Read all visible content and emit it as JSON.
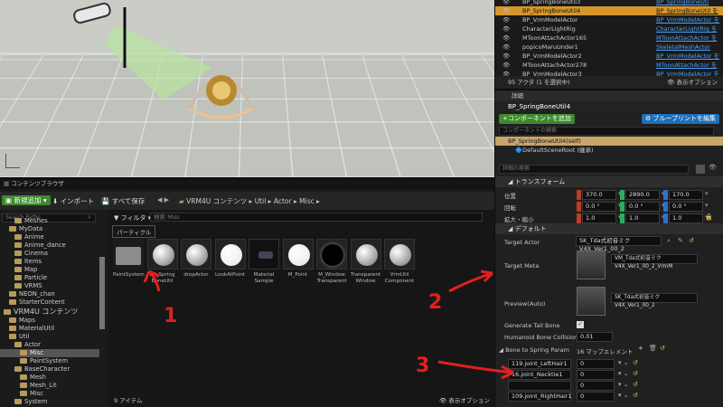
{
  "outliner": {
    "rows": [
      {
        "name": "BP_SpringBoneUtil3",
        "type": "BP_SpringBoneUti",
        "sel": false
      },
      {
        "name": "BP_SpringBoneUtil4",
        "type": "BP_SpringBoneUtil を",
        "sel": true
      },
      {
        "name": "BP_VrmModelActor",
        "type": "BP_VrmModelActor を",
        "sel": false
      },
      {
        "name": "CharacterLightRig",
        "type": "CharacterLightRig を",
        "sel": false
      },
      {
        "name": "MToonAttachActor165",
        "type": "MToonAttachActor を",
        "sel": false
      },
      {
        "name": "popicoMaruUnder1",
        "type": "SkeletalMeshActor",
        "sel": false
      },
      {
        "name": "BP_VrmModelActor2",
        "type": "BP_VrmModelActor を",
        "sel": false
      },
      {
        "name": "MToonAttachActor278",
        "type": "MToonAttachActor を",
        "sel": false
      },
      {
        "name": "BP_VrmModelActor3",
        "type": "BP_VrmModelActor を",
        "sel": false
      }
    ],
    "footer": "95 アクタ (1 を選択中)",
    "view_options": "表示オプション"
  },
  "details": {
    "tab": "詳細",
    "actor_name": "BP_SpringBoneUtil4",
    "add_component": "+コンポーネントを追加",
    "edit_blueprint": "ブループリントを編集",
    "component_search": "コンポーネントの検索",
    "self_item": "BP_SpringBoneUtil4(self)",
    "root_item": "DefaultSceneRoot (継承)",
    "details_search": "詳細の検索",
    "transform_header": "トランスフォーム",
    "location_label": "位置",
    "rotation_label": "回転",
    "scale_label": "拡大・縮小",
    "location": [
      "370.0",
      "2890.0",
      "170.0"
    ],
    "rotation": [
      "0.0 °",
      "0.0 °",
      "0.0 °"
    ],
    "scale": [
      "1.0",
      "1.0",
      "1.0"
    ],
    "default_header": "デフォルト",
    "target_actor_label": "Target Actor",
    "target_actor_value": "SK_Tda式初音ミクV4X_Ver1_00_2",
    "target_meta_label": "Target Meta",
    "target_meta_value": "VM_Tda式初音ミクV4X_Ver1_00_2_VrmM",
    "preview_label": "Preview(Auto)",
    "preview_value": "SK_Tda式初音ミクV4X_Ver1_00_2",
    "gen_tail_label": "Generate Tail Bone",
    "collision_label": "Humanoid Bone Collision Rad",
    "collision_value": "0.01",
    "bone_map_label": "Bone to Spring Param",
    "bone_map_count": "16 マップエレメント",
    "bones": [
      {
        "key": "119.joint_LeftHair1",
        "val": "0"
      },
      {
        "key": "16.joint_Necktie1",
        "val": "0"
      },
      {
        "key": "",
        "val": "0"
      },
      {
        "key": "109.joint_RightHair1",
        "val": "0"
      }
    ]
  },
  "content_browser": {
    "tab": "コンテンツブラウザ",
    "add_new": "新規追加",
    "import": "インポート",
    "save_all": "すべて保存",
    "path": [
      "VRM4U コンテンツ",
      "Util",
      "Actor",
      "Misc"
    ],
    "filter": "フィルタ",
    "search_placeholder": "検索 Misc",
    "search_paths": "Search Paths",
    "collection": "パーティクル",
    "item_count": "9 アイテム",
    "view_options": "表示オプション",
    "tree": [
      {
        "t": "Meshes",
        "lv": 2,
        "big": false
      },
      {
        "t": "MyData",
        "lv": 1,
        "big": false
      },
      {
        "t": "Anime",
        "lv": 2,
        "big": false
      },
      {
        "t": "Anime_dance",
        "lv": 2,
        "big": false
      },
      {
        "t": "Cinema",
        "lv": 2,
        "big": false
      },
      {
        "t": "Items",
        "lv": 2,
        "big": false
      },
      {
        "t": "Map",
        "lv": 2,
        "big": false
      },
      {
        "t": "Particle",
        "lv": 2,
        "big": false
      },
      {
        "t": "VRMS",
        "lv": 2,
        "big": false
      },
      {
        "t": "NEON_chan",
        "lv": 1,
        "big": false
      },
      {
        "t": "StarterContent",
        "lv": 1,
        "big": false
      },
      {
        "t": "VRM4U コンテンツ",
        "lv": 0,
        "big": true
      },
      {
        "t": "Maps",
        "lv": 1,
        "big": false
      },
      {
        "t": "MaterialUtil",
        "lv": 1,
        "big": false
      },
      {
        "t": "Util",
        "lv": 1,
        "big": false
      },
      {
        "t": "Actor",
        "lv": 2,
        "big": false
      },
      {
        "t": "Misc",
        "lv": 3,
        "big": false,
        "sel": true
      },
      {
        "t": "PaintSystem",
        "lv": 3,
        "big": false
      },
      {
        "t": "BaseCharacter",
        "lv": 2,
        "big": false
      },
      {
        "t": "Mesh",
        "lv": 3,
        "big": false
      },
      {
        "t": "Mesh_Lit",
        "lv": 3,
        "big": false
      },
      {
        "t": "Misc",
        "lv": 3,
        "big": false
      },
      {
        "t": "System",
        "lv": 2,
        "big": false
      },
      {
        "t": "VRM4U C++ クラス",
        "lv": 0,
        "big": true
      }
    ],
    "assets": [
      {
        "name": "PaintSystem",
        "kind": "folder"
      },
      {
        "name": "BP_Spring BoneUtil",
        "kind": "sphere"
      },
      {
        "name": "dropActor",
        "kind": "sphere"
      },
      {
        "name": "LookAtPoint",
        "kind": "white"
      },
      {
        "name": "Material Sample",
        "kind": "dark"
      },
      {
        "name": "M_Point",
        "kind": "white"
      },
      {
        "name": "M_Window Transparent",
        "kind": "black"
      },
      {
        "name": "Transparent Window",
        "kind": "sphere"
      },
      {
        "name": "VrmUtil Component",
        "kind": "sphere"
      }
    ]
  },
  "annotations": [
    "1",
    "2",
    "3"
  ]
}
